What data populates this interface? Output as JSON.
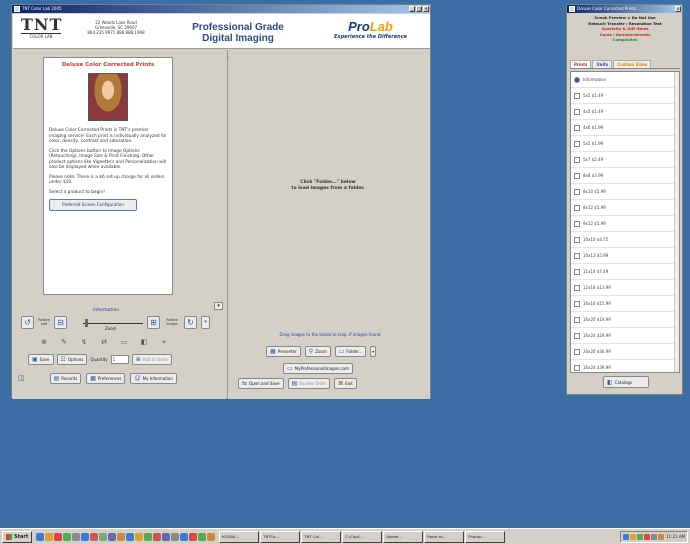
{
  "main_window": {
    "title": "TNT Color Lab 2005",
    "controls": [
      "_",
      "□",
      "×"
    ],
    "header": {
      "logo_big": "TNT",
      "logo_small": "COLOR LAB",
      "address_lines": [
        "22 Woods Lake Road",
        "Greenville, SC 29607",
        "864.235.9971  888.888.1998"
      ],
      "title_line1": "Professional Grade",
      "title_line2": "Digital Imaging",
      "prolab_pre": "Pro",
      "prolab_post": "Lab",
      "prolab_tag": "Experience the Difference"
    },
    "product": {
      "title": "Deluxe Color Corrected Prints",
      "desc1": "Deluxe Color Corrected Prints is TNT's premier imaging service! Each print is individually analyzed for color, density, contrast and saturation.",
      "desc2": "Click the Options button to Image Options (Retouching), Image Size & Print Finishing. Other product options like Vignette's and Personalization will also be displayed when available.",
      "desc3": "Please note: There is a $6 set-up charge for all orders under $10.",
      "desc4": "Select a product to begin!",
      "pref_btn": "Preferred Screen Configuration"
    },
    "controls_area": {
      "info_label": "Information",
      "rotate_left": "Rotate Left",
      "rotate_right": "Rotate Image",
      "zoom_label": "Zoom",
      "tools": [
        "⊕",
        "✎",
        "↯",
        "⇄",
        "▭",
        "◧",
        "⌖"
      ],
      "save_btn": "Save",
      "options_btn": "Options",
      "quantity_label": "Quantity",
      "quantity_value": "1",
      "add_order_btn": "Add to Order",
      "records_btn": "Records",
      "preferences_btn": "Preferences",
      "my_info_btn": "My Information"
    },
    "right_pane": {
      "load_line1": "Click \"Folder...\" below",
      "load_line2": "to load images from a folder.",
      "drag_msg": "Drag images to the below to crop. If images found.",
      "presenter_btn": "Presenter",
      "zoom_btn": "Zoom",
      "folder_btn": "Folder...",
      "url_btn": "MyProfessionalImages.com",
      "open_save_btn": "Open and Save",
      "review_btn": "Review Order",
      "exit_btn": "Exit"
    }
  },
  "side_window": {
    "title": "Deluxe Color Corrected Prints",
    "lines": [
      {
        "text": "Sneak Preview = Do Not Use",
        "color": "#222222"
      },
      {
        "text": "Retouch Transfer / Resolution Test",
        "color": "#222222"
      },
      {
        "text": "Specialty & Gift Items",
        "color": "#cc2222"
      },
      {
        "text": "Cards / Announcements",
        "color": "#cc2222"
      },
      {
        "text": "Composites",
        "color": "#228822"
      }
    ],
    "tabs": [
      {
        "label": "Prints",
        "color": "#cc2222"
      },
      {
        "label": "Units",
        "color": "#2244aa"
      },
      {
        "label": "Custom Sizes",
        "color": "#e08800"
      }
    ],
    "list_items": [
      "Information",
      "5x5 $1.49",
      "4x5 $1.49",
      "4x6 $1.99",
      "5x5 $1.99",
      "5x7 $2.49",
      "8x8 $3.99",
      "8x10 $5.99",
      "8x12 $5.99",
      "9x12 $5.99",
      "10x10 $4.75",
      "10x13 $5.99",
      "11x14 $7.49",
      "12x18 $13.99",
      "16x16 $15.99",
      "16x20 $19.99",
      "16x24 $29.99",
      "20x20 $36.99",
      "16x24 $39.99",
      "20x24 $36.99"
    ],
    "catalogs_btn": "Catalogs"
  },
  "taskbar": {
    "start_label": "Start",
    "quick_launch_colors": [
      "#3a7bd5",
      "#e0a030",
      "#d44",
      "#5a5",
      "#888",
      "#3a7bd5",
      "#c55",
      "#7a7",
      "#66a",
      "#c84",
      "#3a7bd5",
      "#e0a030",
      "#5a5",
      "#c55",
      "#66a",
      "#888",
      "#3a7bd5",
      "#d44",
      "#5a5",
      "#c84"
    ],
    "tasks": [
      "KODAK...",
      "TNTCo...",
      "TNT Col...",
      "C:\\Capt...",
      "Adobe...",
      "Rosie wi...",
      "Photop..."
    ],
    "tray_colors": [
      "#3a7bd5",
      "#e0a030",
      "#5a5",
      "#d44",
      "#888",
      "#c84"
    ],
    "clock": "11:21 AM"
  }
}
